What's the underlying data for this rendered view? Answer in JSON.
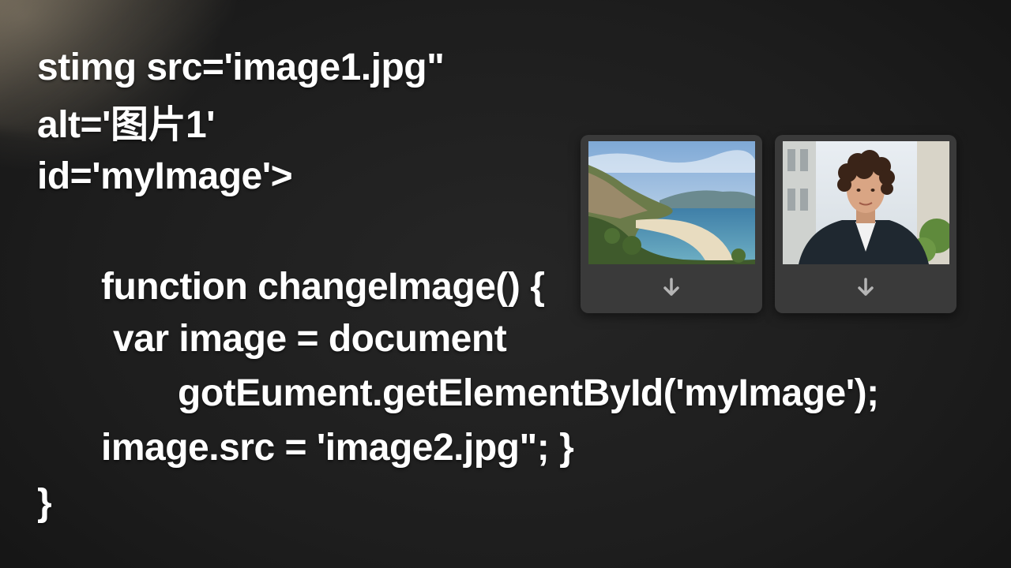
{
  "code": {
    "lines": [
      "stimg src='image1.jpg\"",
      "alt='图片1'",
      "id='myImage'>",
      "function changeImage() {",
      "var image = document",
      "gotEument.getElementById('myImage');",
      "image.src = 'image2.jpg\"; }",
      "}"
    ]
  },
  "images": [
    {
      "subject": "coastal-beach-photo",
      "action_icon": "download-arrow-icon"
    },
    {
      "subject": "portrait-photo",
      "action_icon": "download-arrow-icon"
    }
  ],
  "colors": {
    "background": "#1d1d1d",
    "text": "#ffffff",
    "card": "#3a3a3a",
    "icon": "#b5b5b5"
  }
}
